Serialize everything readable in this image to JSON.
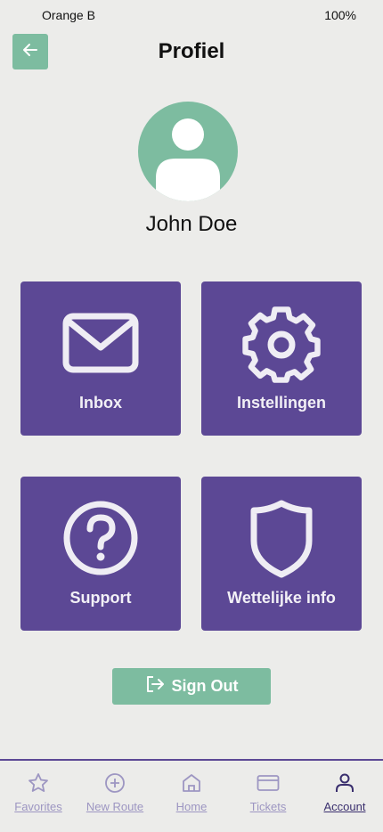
{
  "status_bar": {
    "carrier": "Orange B",
    "battery": "100%"
  },
  "header": {
    "title": "Profiel",
    "back_icon": "arrow-left-icon"
  },
  "profile": {
    "name": "John Doe",
    "avatar_icon": "user-avatar-icon"
  },
  "tiles": [
    {
      "label": "Inbox",
      "icon": "mail-icon"
    },
    {
      "label": "Instellingen",
      "icon": "gear-icon"
    },
    {
      "label": "Support",
      "icon": "question-circle-icon"
    },
    {
      "label": "Wettelijke info",
      "icon": "shield-icon"
    }
  ],
  "signout": {
    "label": "Sign Out",
    "icon": "sign-out-icon"
  },
  "tabbar": {
    "items": [
      {
        "label": "Favorites",
        "icon": "star-icon",
        "active": false
      },
      {
        "label": "New Route",
        "icon": "plus-circle-icon",
        "active": false
      },
      {
        "label": "Home",
        "icon": "home-icon",
        "active": false
      },
      {
        "label": "Tickets",
        "icon": "card-icon",
        "active": false
      },
      {
        "label": "Account",
        "icon": "user-icon",
        "active": true
      }
    ]
  },
  "colors": {
    "background": "#ececea",
    "accent_green": "#7dbca0",
    "tile_purple": "#5c4895",
    "tab_inactive": "#9d96c2",
    "tab_active": "#3a2f6e"
  }
}
